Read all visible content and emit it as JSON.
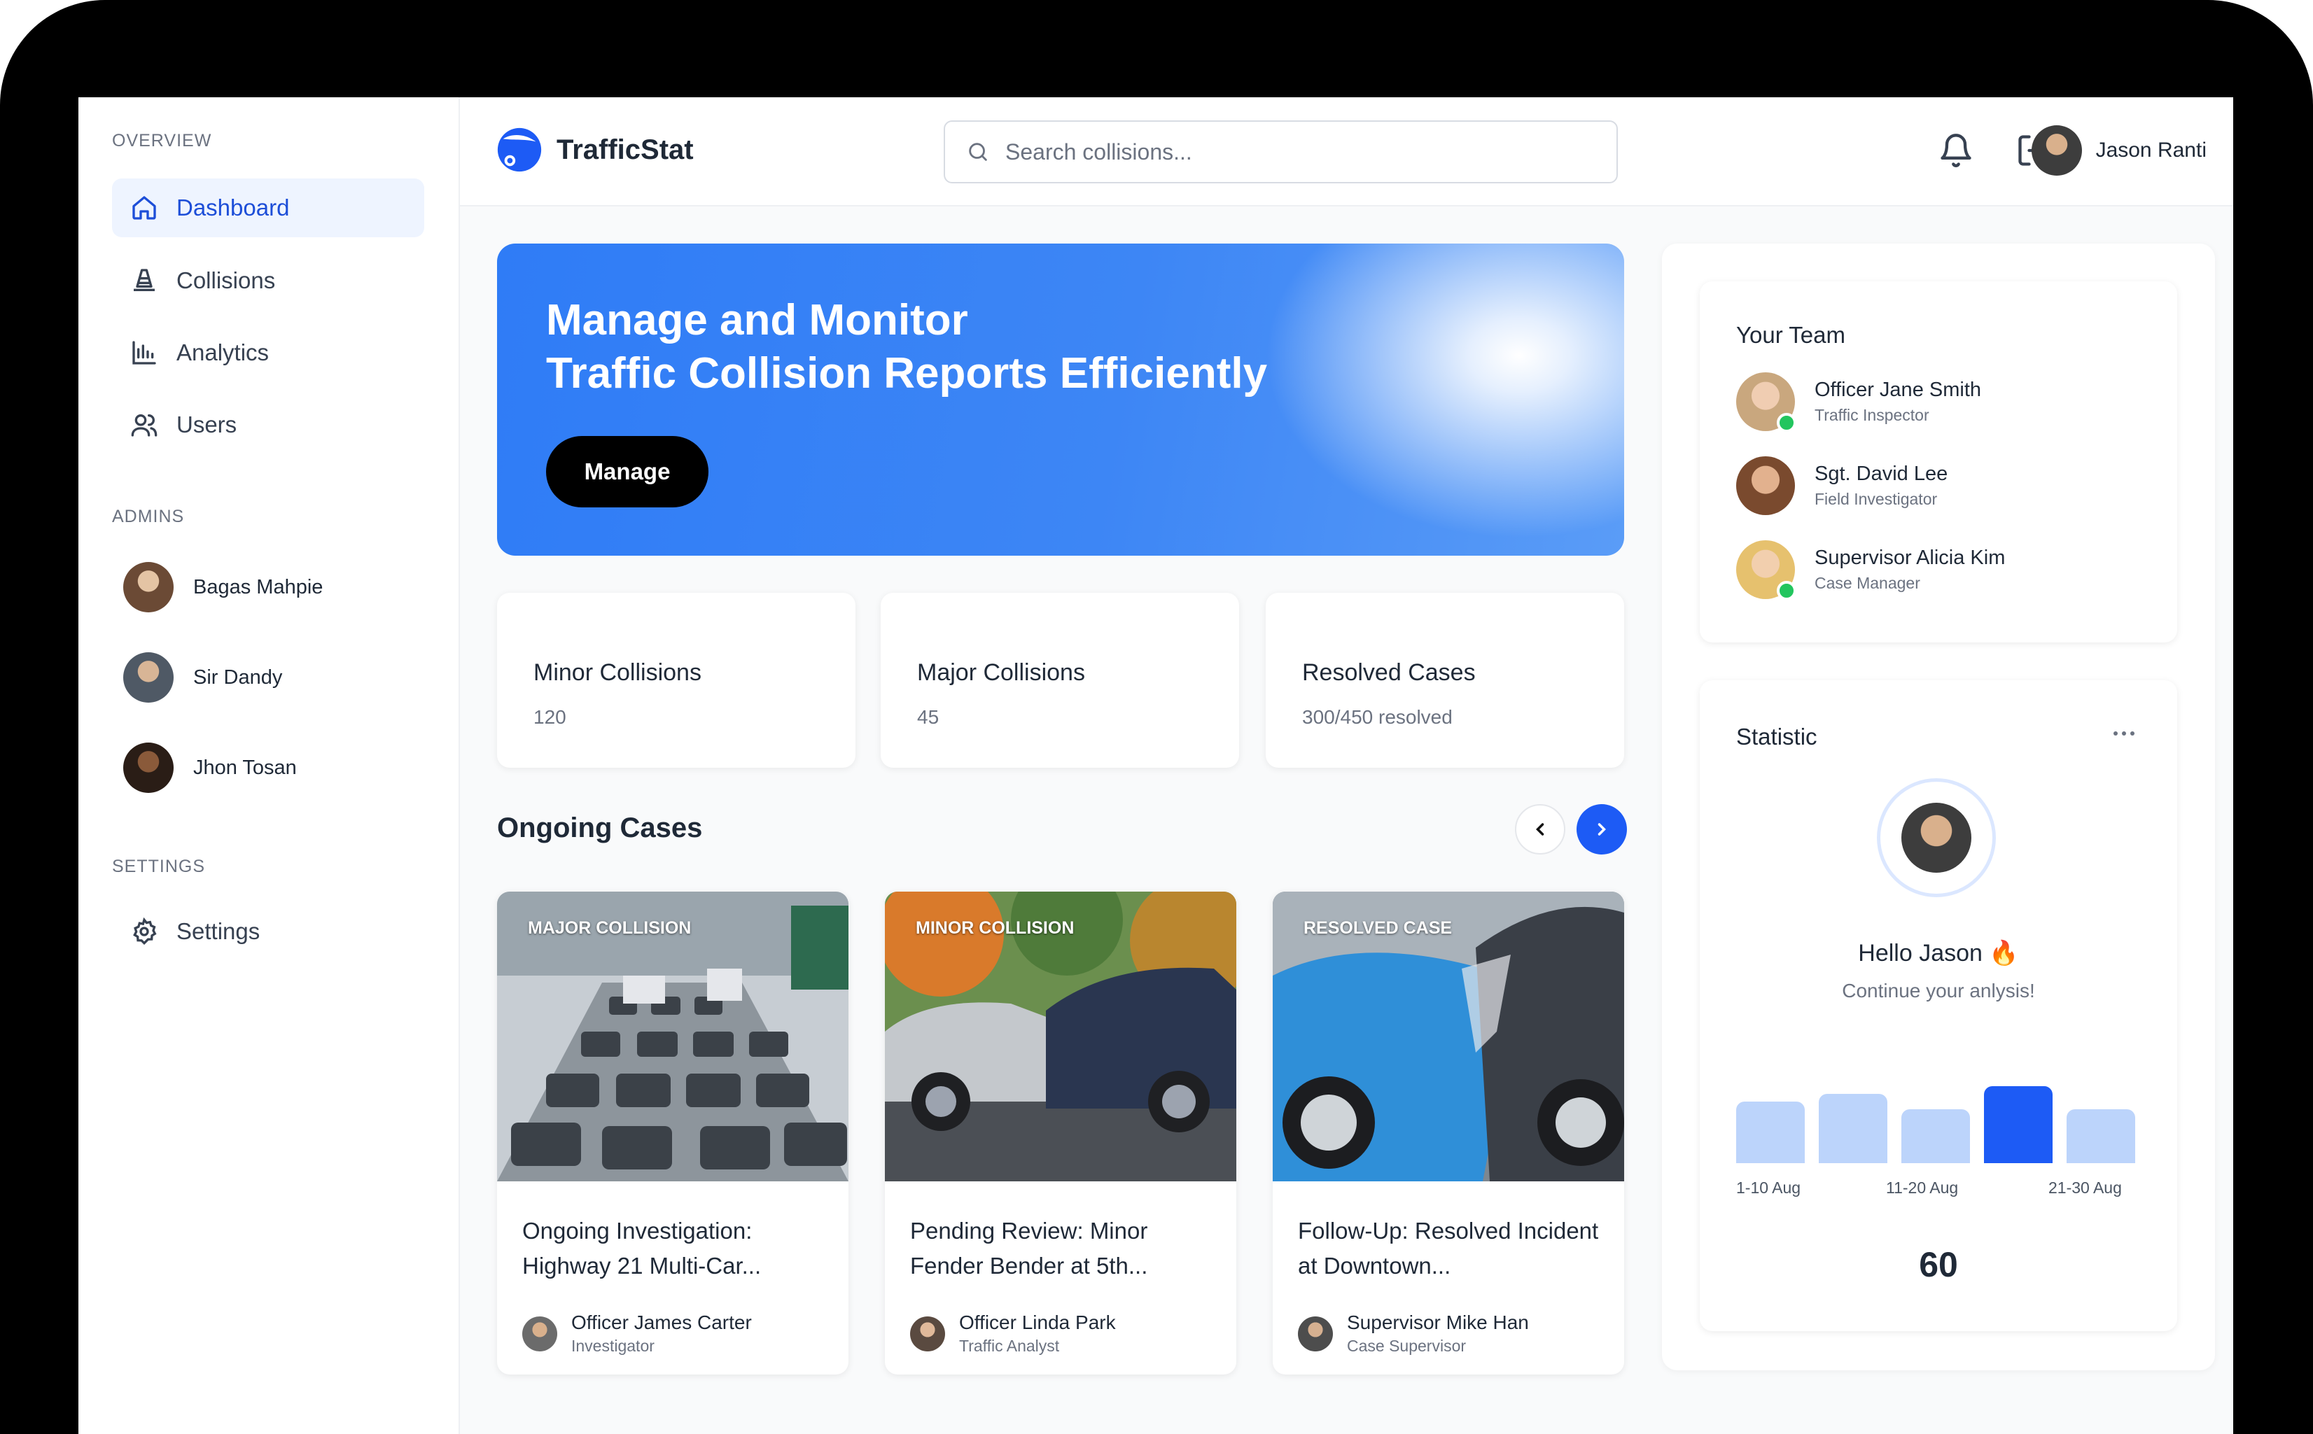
{
  "sidebar": {
    "overview_title": "OVERVIEW",
    "nav": [
      {
        "label": "Dashboard",
        "icon": "home-icon",
        "active": true
      },
      {
        "label": "Collisions",
        "icon": "cone-icon"
      },
      {
        "label": "Analytics",
        "icon": "chart-icon"
      },
      {
        "label": "Users",
        "icon": "users-icon"
      }
    ],
    "admins_title": "ADMINS",
    "admins": [
      {
        "name": "Bagas Mahpie"
      },
      {
        "name": "Sir Dandy"
      },
      {
        "name": "Jhon Tosan"
      }
    ],
    "settings_title": "SETTINGS",
    "settings_label": "Settings"
  },
  "header": {
    "brand": "TrafficStat",
    "search_placeholder": "Search collisions...",
    "user_name": "Jason Ranti"
  },
  "hero": {
    "title_line1": "Manage and Monitor",
    "title_line2": "Traffic Collision Reports Efficiently",
    "button": "Manage"
  },
  "stats": [
    {
      "title": "Minor Collisions",
      "value": "120"
    },
    {
      "title": "Major Collisions",
      "value": "45"
    },
    {
      "title": "Resolved Cases",
      "value": "300/450 resolved"
    }
  ],
  "ongoing": {
    "title": "Ongoing Cases",
    "cases": [
      {
        "tag": "MAJOR COLLISION",
        "title": "Ongoing Investigation: Highway 21 Multi-Car...",
        "officer": "Officer James Carter",
        "role": "Investigator"
      },
      {
        "tag": "MINOR COLLISION",
        "title": "Pending Review: Minor Fender Bender at 5th...",
        "officer": "Officer Linda Park",
        "role": "Traffic Analyst"
      },
      {
        "tag": "RESOLVED CASE",
        "title": "Follow-Up: Resolved Incident at Downtown...",
        "officer": "Supervisor Mike Han",
        "role": "Case Supervisor"
      }
    ]
  },
  "team": {
    "title": "Your Team",
    "members": [
      {
        "name": "Officer Jane Smith",
        "role": "Traffic Inspector",
        "online": true
      },
      {
        "name": "Sgt. David Lee",
        "role": "Field Investigator",
        "online": false
      },
      {
        "name": "Supervisor Alicia Kim",
        "role": "Case Manager",
        "online": true
      }
    ]
  },
  "statistic": {
    "title": "Statistic",
    "greeting": "Hello Jason 🔥",
    "subtitle": "Continue your anlysis!",
    "total": "60",
    "accent_color": "#1d5bf5",
    "bar_color": "#bcd4fb"
  },
  "chart_data": {
    "type": "bar",
    "categories": [
      "1-10 Aug",
      "",
      "11-20 Aug",
      "",
      "21-30 Aug"
    ],
    "values": [
      8,
      9,
      7,
      10,
      7
    ],
    "highlight_index": 3,
    "tick_labels": [
      "1-10 Aug",
      "11-20 Aug",
      "21-30 Aug"
    ]
  }
}
